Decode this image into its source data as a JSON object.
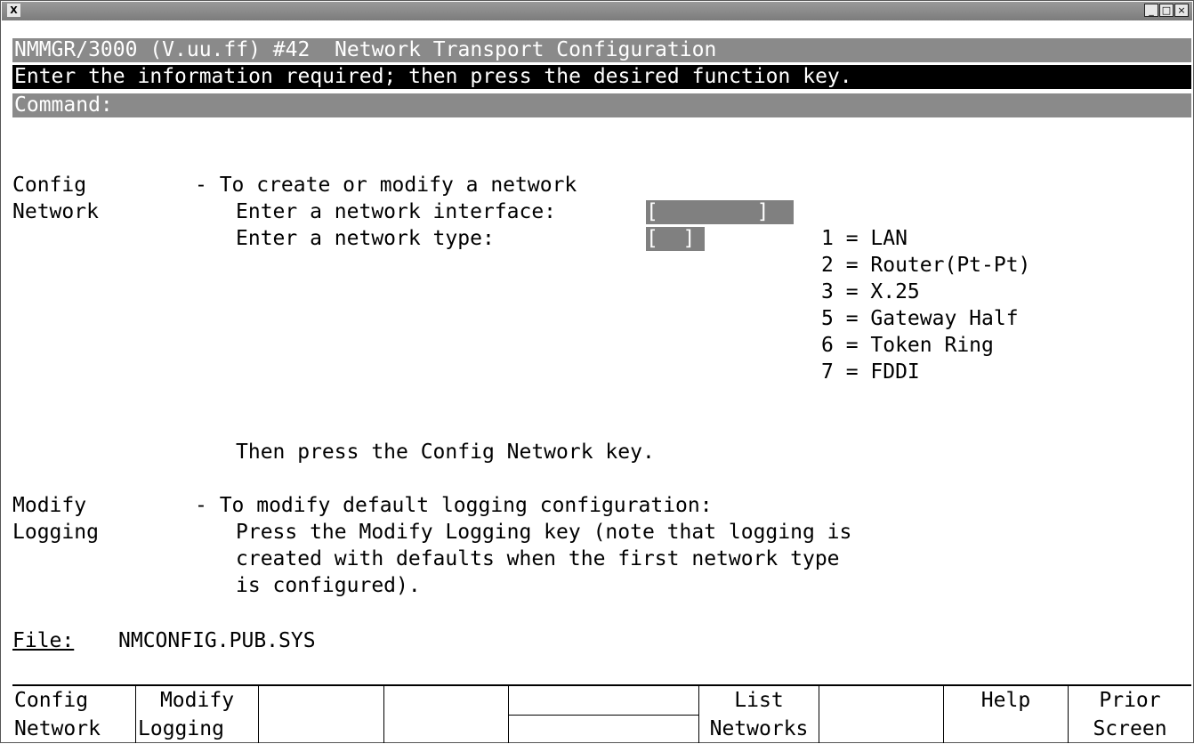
{
  "window": {
    "icon": "x-logo-icon",
    "logo_text": "X",
    "buttons": [
      "minimize-icon",
      "maximize-icon",
      "close-icon"
    ],
    "button_glyphs": [
      "_",
      "□",
      "×"
    ]
  },
  "header": {
    "title": "NMMGR/3000 (V.uu.ff) #42  Network Transport Configuration",
    "instruction": "Enter the information required; then press the desired function key.",
    "command_label": "Command:"
  },
  "config": {
    "label1": "Config",
    "label2": "Network",
    "desc": "- To create or modify a network",
    "interface_prompt": "Enter a network interface:",
    "interface_field": "[        ]",
    "type_prompt": "Enter a network type:",
    "type_field": "[  ]",
    "options": [
      "1 = LAN",
      "2 = Router(Pt-Pt)",
      "3 = X.25",
      "5 = Gateway Half",
      "6 = Token Ring",
      "7 = FDDI"
    ],
    "then": "Then press the Config Network key."
  },
  "logging": {
    "label1": "Modify",
    "label2": "Logging",
    "desc": "- To modify default logging configuration:",
    "line1": "Press the Modify Logging key (note that logging is",
    "line2": "created with defaults when the first network type",
    "line3": "is configured)."
  },
  "file": {
    "label": "File:",
    "value": "NMCONFIG.PUB.SYS"
  },
  "function_keys": [
    {
      "l1": "Config",
      "l2": "Network"
    },
    {
      "l1": "Modify",
      "l2": "Logging"
    },
    {
      "l1": "",
      "l2": ""
    },
    {
      "l1": "",
      "l2": ""
    },
    {
      "l1": "",
      "l2": ""
    },
    {
      "l1": "List",
      "l2": "Networks"
    },
    {
      "l1": "",
      "l2": ""
    },
    {
      "l1": "Help",
      "l2": ""
    },
    {
      "l1": "Prior",
      "l2": "Screen"
    }
  ]
}
